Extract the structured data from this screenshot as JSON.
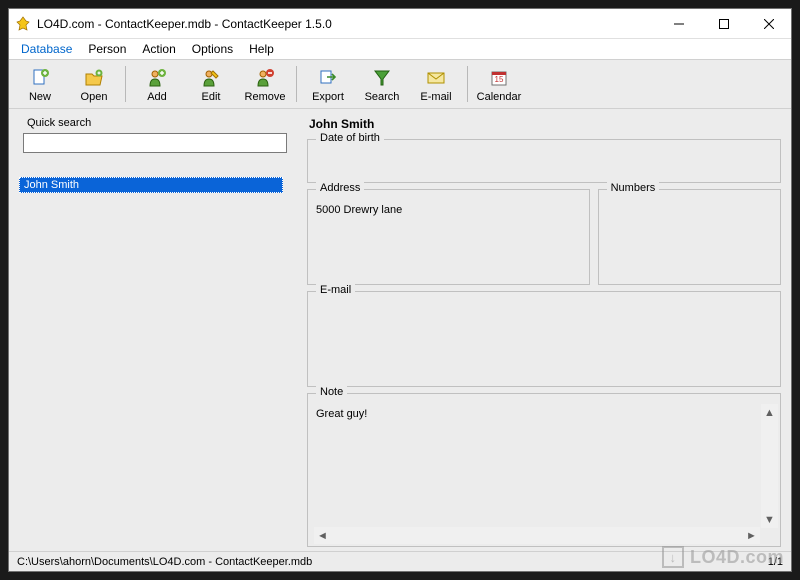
{
  "title": "LO4D.com - ContactKeeper.mdb - ContactKeeper 1.5.0",
  "menus": [
    "Database",
    "Person",
    "Action",
    "Options",
    "Help"
  ],
  "toolbar": [
    {
      "name": "new",
      "label": "New"
    },
    {
      "name": "open",
      "label": "Open"
    },
    {
      "sep": true
    },
    {
      "name": "add",
      "label": "Add"
    },
    {
      "name": "edit",
      "label": "Edit"
    },
    {
      "name": "remove",
      "label": "Remove"
    },
    {
      "sep": true
    },
    {
      "name": "export",
      "label": "Export"
    },
    {
      "name": "search",
      "label": "Search"
    },
    {
      "name": "email",
      "label": "E-mail"
    },
    {
      "sep": true
    },
    {
      "name": "calendar",
      "label": "Calendar"
    }
  ],
  "quick_search": {
    "label": "Quick search",
    "value": ""
  },
  "contacts": [
    {
      "name": "John Smith",
      "selected": true
    }
  ],
  "person": {
    "name": "John Smith",
    "dob_label": "Date of birth",
    "dob": "",
    "address_label": "Address",
    "address": "5000 Drewry lane",
    "numbers_label": "Numbers",
    "numbers": "",
    "email_label": "E-mail",
    "email": "",
    "note_label": "Note",
    "note": "Great guy!"
  },
  "status": {
    "path": "C:\\Users\\ahorn\\Documents\\LO4D.com - ContactKeeper.mdb",
    "count": "1/1"
  },
  "watermark": "LO4D.com"
}
